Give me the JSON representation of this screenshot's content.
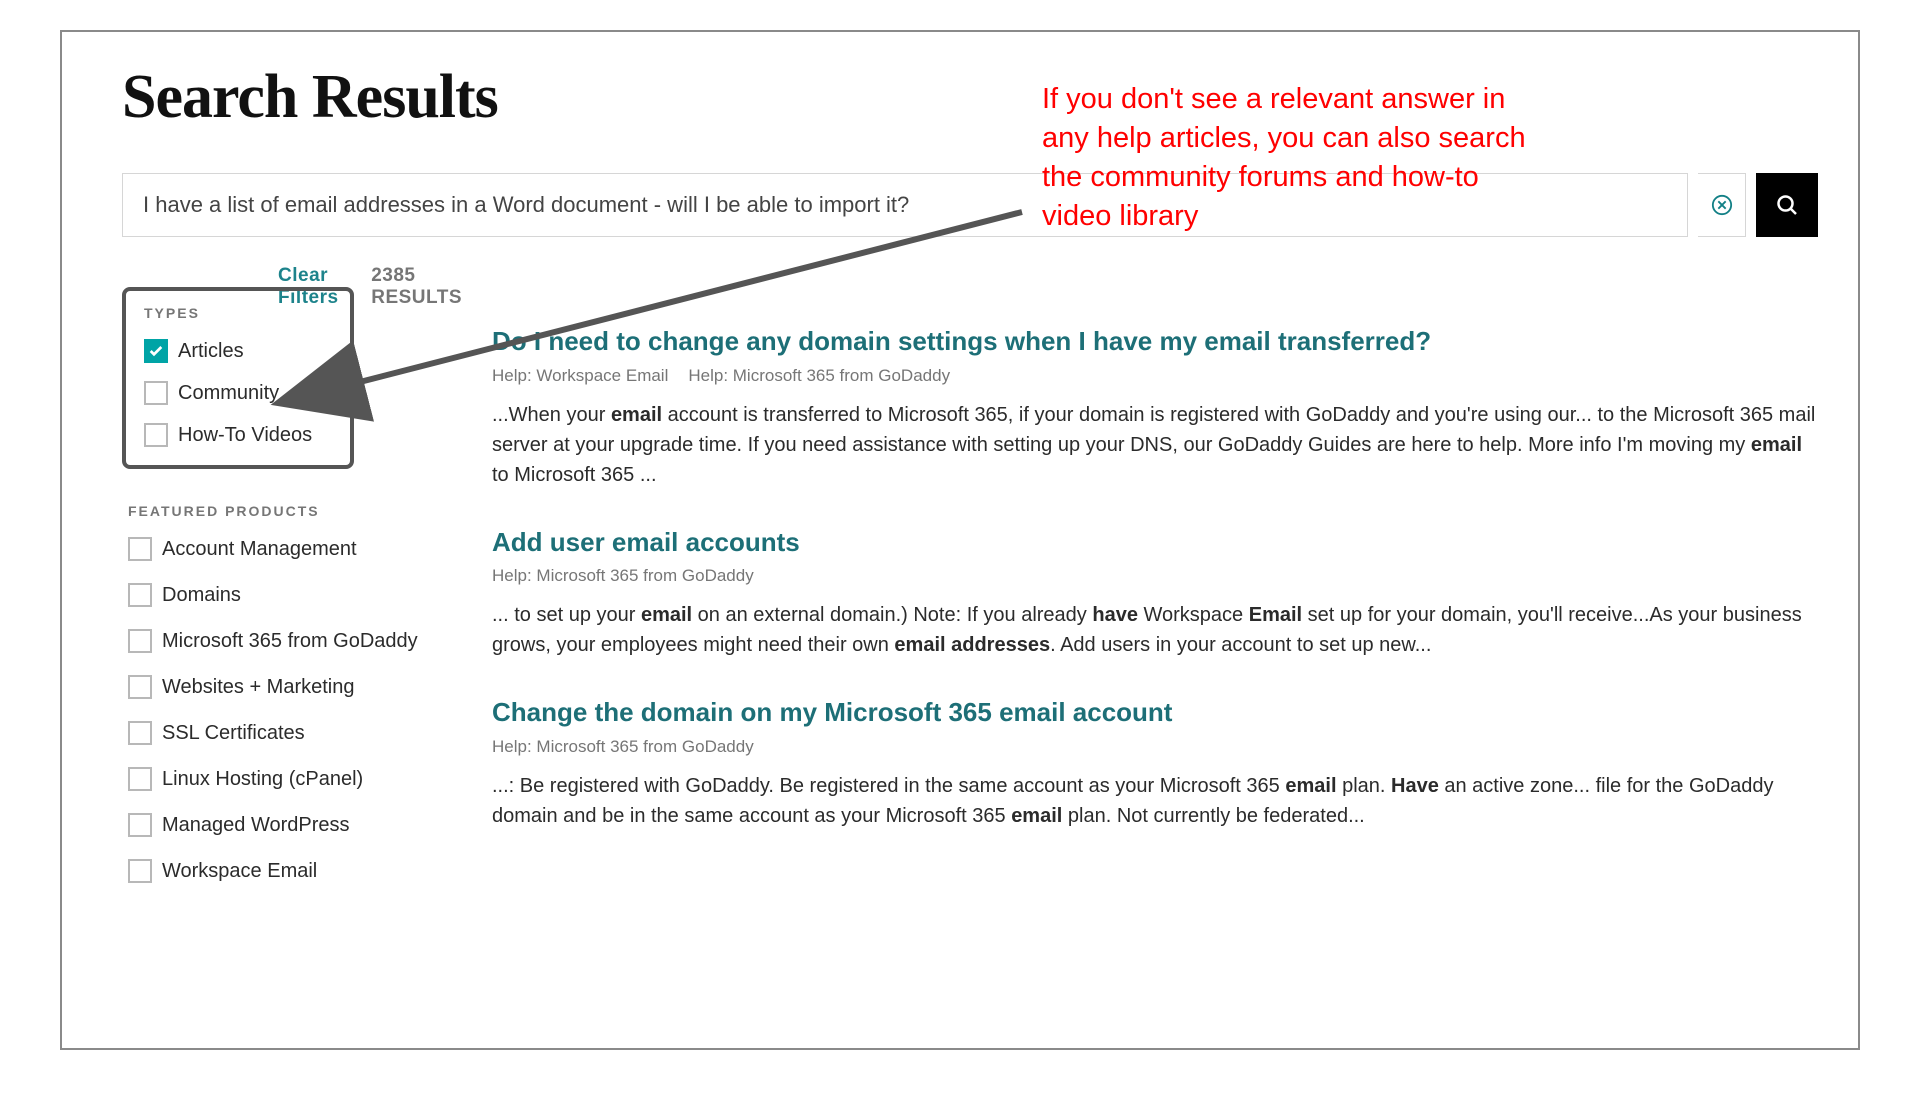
{
  "header": {
    "title": "Search Results"
  },
  "search": {
    "value": "I have a list of email addresses in a Word document - will I be able to import it?"
  },
  "filters": {
    "clear_label": "Clear Filters",
    "results_count": "2385 RESULTS",
    "types_header": "TYPES",
    "types": [
      {
        "label": "Articles",
        "checked": true
      },
      {
        "label": "Community",
        "checked": false
      },
      {
        "label": "How-To Videos",
        "checked": false
      }
    ],
    "featured_header": "FEATURED PRODUCTS",
    "featured": [
      {
        "label": "Account Management"
      },
      {
        "label": "Domains"
      },
      {
        "label": "Microsoft 365 from GoDaddy"
      },
      {
        "label": "Websites + Marketing"
      },
      {
        "label": "SSL Certificates"
      },
      {
        "label": "Linux Hosting (cPanel)"
      },
      {
        "label": "Managed WordPress"
      },
      {
        "label": "Workspace Email"
      }
    ]
  },
  "results": [
    {
      "title": "Do I need to change any domain settings when I have my email transferred?",
      "crumbs": [
        "Help: Workspace Email",
        "Help: Microsoft 365 from GoDaddy"
      ],
      "snippet_html": "...When your <strong>email</strong> account is transferred to Microsoft 365, if your domain is registered with GoDaddy and you're using our... to the Microsoft 365 mail server at your upgrade time. If you need assistance with setting up your DNS, our GoDaddy Guides are here to help. More info I'm moving my <strong>email</strong> to Microsoft 365 ..."
    },
    {
      "title": "Add user email accounts",
      "crumbs": [
        "Help: Microsoft 365 from GoDaddy"
      ],
      "snippet_html": "... to set up your <strong>email</strong> on an external domain.) Note: If you already <strong>have</strong> Workspace <strong>Email</strong> set up for your domain, you'll receive...As your business grows, your employees might need their own <strong>email addresses</strong>. Add users in your account to set up new..."
    },
    {
      "title": "Change the domain on my Microsoft 365 email account",
      "crumbs": [
        "Help: Microsoft 365 from GoDaddy"
      ],
      "snippet_html": "...: Be registered with GoDaddy. Be registered in the same account as your Microsoft 365 <strong>email</strong> plan. <strong>Have</strong> an active zone... file for the GoDaddy domain and be in the same account as your Microsoft 365 <strong>email</strong> plan. Not currently be federated..."
    }
  ],
  "annotation": {
    "text": "If you don't see a relevant answer in any help articles, you can also search the community forums and how-to video library"
  },
  "colors": {
    "accent_teal": "#00a4a6",
    "link_teal": "#1d6f77",
    "annotation_red": "#ff0000"
  }
}
